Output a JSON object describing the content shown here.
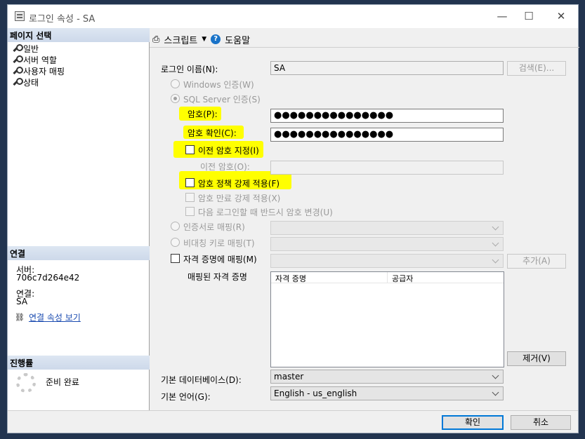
{
  "window": {
    "title": "로그인 속성 - SA",
    "minimize": "—",
    "maximize": "☐",
    "close": "✕"
  },
  "left": {
    "page_select_header": "페이지 선택",
    "pages": [
      "일반",
      "서버 역할",
      "사용자 매핑",
      "상태"
    ],
    "connection_header": "연결",
    "server_label": "서버:",
    "server_value": "706c7d264e42",
    "conn_label": "연결:",
    "conn_value": "SA",
    "view_conn_props": "연결 속성 보기",
    "progress_header": "진행률",
    "progress_status": "준비 완료"
  },
  "toolbar": {
    "script_label": "스크립트",
    "help_label": "도움말"
  },
  "form": {
    "login_name_label": "로그인 이름(N):",
    "login_name_value": "SA",
    "search_button": "검색(E)...",
    "windows_auth": "Windows 인증(W)",
    "sql_auth": "SQL Server 인증(S)",
    "password_label": "암호(P):",
    "password_value": "●●●●●●●●●●●●●●●",
    "confirm_label": "암호 확인(C):",
    "confirm_value": "●●●●●●●●●●●●●●●",
    "specify_old": "이전 암호 지정(I)",
    "old_password_label": "이전 암호(O):",
    "enforce_policy": "암호 정책 강제 적용(F)",
    "enforce_expiration": "암호 만료 강제 적용(X)",
    "must_change": "다음 로그인할 때 반드시 암호 변경(U)",
    "cert_mapping": "인증서로 매핑(R)",
    "asym_key_mapping": "비대칭 키로 매핑(T)",
    "credential_mapping": "자격 증명에 매핑(M)",
    "add_button": "추가(A)",
    "mapped_credentials_label": "매핑된 자격 증명",
    "grid_headers": [
      "자격 증명",
      "공급자"
    ],
    "remove_button": "제거(V)",
    "default_db_label": "기본 데이터베이스(D):",
    "default_db_value": "master",
    "default_lang_label": "기본 언어(G):",
    "default_lang_value": "English - us_english"
  },
  "footer": {
    "ok": "확인",
    "cancel": "취소"
  }
}
